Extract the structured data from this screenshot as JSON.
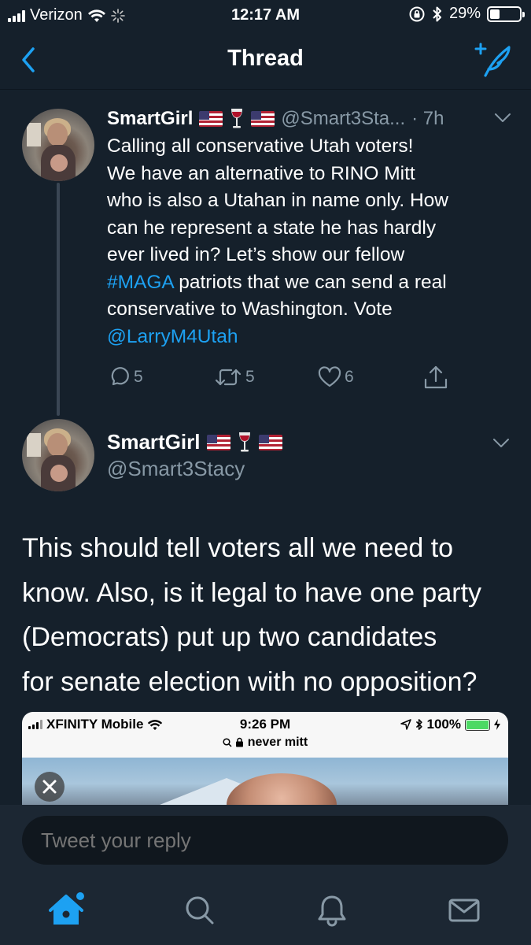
{
  "status_bar": {
    "carrier": "Verizon",
    "time": "12:17 AM",
    "battery": "29%",
    "battery_level": 0.29
  },
  "nav": {
    "title": "Thread"
  },
  "tweet1": {
    "name": "SmartGirl",
    "handle": "@Smart3Sta...",
    "time": "· 7h",
    "text_lines": [
      "Calling all conservative Utah voters!",
      "We have an alternative to RINO Mitt",
      "who is also a Utahan in name only. How",
      "can he represent a state he has hardly",
      "ever lived in?  Let’s show our fellow"
    ],
    "hashtag": "#MAGA",
    "line6_rest": " patriots that we can send a real",
    "line7": "conservative to Washington. Vote",
    "mention": "@LarryM4Utah",
    "replies": "5",
    "retweets": "5",
    "likes": "6"
  },
  "tweet2": {
    "name": "SmartGirl",
    "handle": "@Smart3Stacy",
    "text_lines": [
      "This should tell voters all we need to",
      "know. Also, is it legal to have one party",
      "(Democrats) put up two candidates",
      "for senate election with no opposition?"
    ]
  },
  "embedded_screenshot": {
    "carrier": "XFINITY Mobile",
    "time": "9:26 PM",
    "battery": "100%",
    "url": "never mitt"
  },
  "reply": {
    "placeholder": "Tweet your reply"
  },
  "icons": {
    "tab_home": "home-icon",
    "tab_search": "search-icon",
    "tab_notifications": "bell-icon",
    "tab_messages": "mail-icon"
  },
  "colors": {
    "background": "#15202b",
    "accent": "#1da1f2",
    "secondary_text": "#8899a6"
  }
}
